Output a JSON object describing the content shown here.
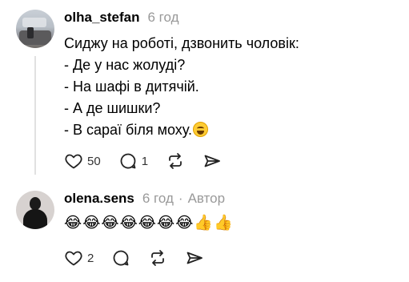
{
  "posts": [
    {
      "username": "olha_stefan",
      "time": "6 год",
      "lines": [
        "Сиджу на роботі, дзвонить чоловік:",
        "- Де у нас жолуді?",
        "- На шафі в дитячій.",
        "- А де шишки?",
        "- В сараї біля моху."
      ],
      "trailing_emoji": "rolling-on-floor-laughing",
      "likes": "50",
      "replies": "1"
    },
    {
      "username": "olena.sens",
      "time": "6 год",
      "separator": "·",
      "badge": "Автор",
      "content": "😂😂😂😂😂😂😂👍👍",
      "likes": "2"
    }
  ],
  "icons": [
    "heart-icon",
    "comment-icon",
    "repost-icon",
    "share-icon"
  ],
  "colors": {
    "muted": "#999999",
    "thread_line": "#e1e1e1"
  }
}
